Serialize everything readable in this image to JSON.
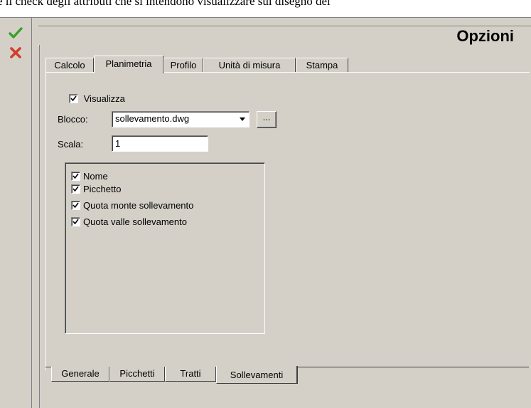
{
  "doc_text": "e il check degli attributi che si intendono visualizzare sul disegno dei",
  "header": {
    "title": "Opzioni"
  },
  "toolbar": {
    "ok_icon": "check-icon",
    "cancel_icon": "close-icon"
  },
  "top_tabs": [
    {
      "label": "Calcolo"
    },
    {
      "label": "Planimetria",
      "active": true
    },
    {
      "label": "Profilo"
    },
    {
      "label": "Unità di misura"
    },
    {
      "label": "Stampa"
    }
  ],
  "form": {
    "visualizza": {
      "label": "Visualizza",
      "checked": true
    },
    "blocco": {
      "label": "Blocco:",
      "value": "sollevamento.dwg"
    },
    "browse_label": "...",
    "scala": {
      "label": "Scala:",
      "value": "1"
    },
    "attributes": [
      {
        "label": "Nome",
        "checked": true
      },
      {
        "label": "Picchetto",
        "checked": true
      },
      {
        "label": "Quota monte sollevamento",
        "checked": true
      },
      {
        "label": "Quota valle sollevamento",
        "checked": true
      }
    ]
  },
  "bottom_tabs": [
    {
      "label": "Generale"
    },
    {
      "label": "Picchetti"
    },
    {
      "label": "Tratti"
    },
    {
      "label": "Sollevamenti",
      "active": true
    }
  ],
  "colors": {
    "ok": "#3aa02a",
    "cancel": "#d23c2a",
    "face": "#d4d0c8"
  }
}
